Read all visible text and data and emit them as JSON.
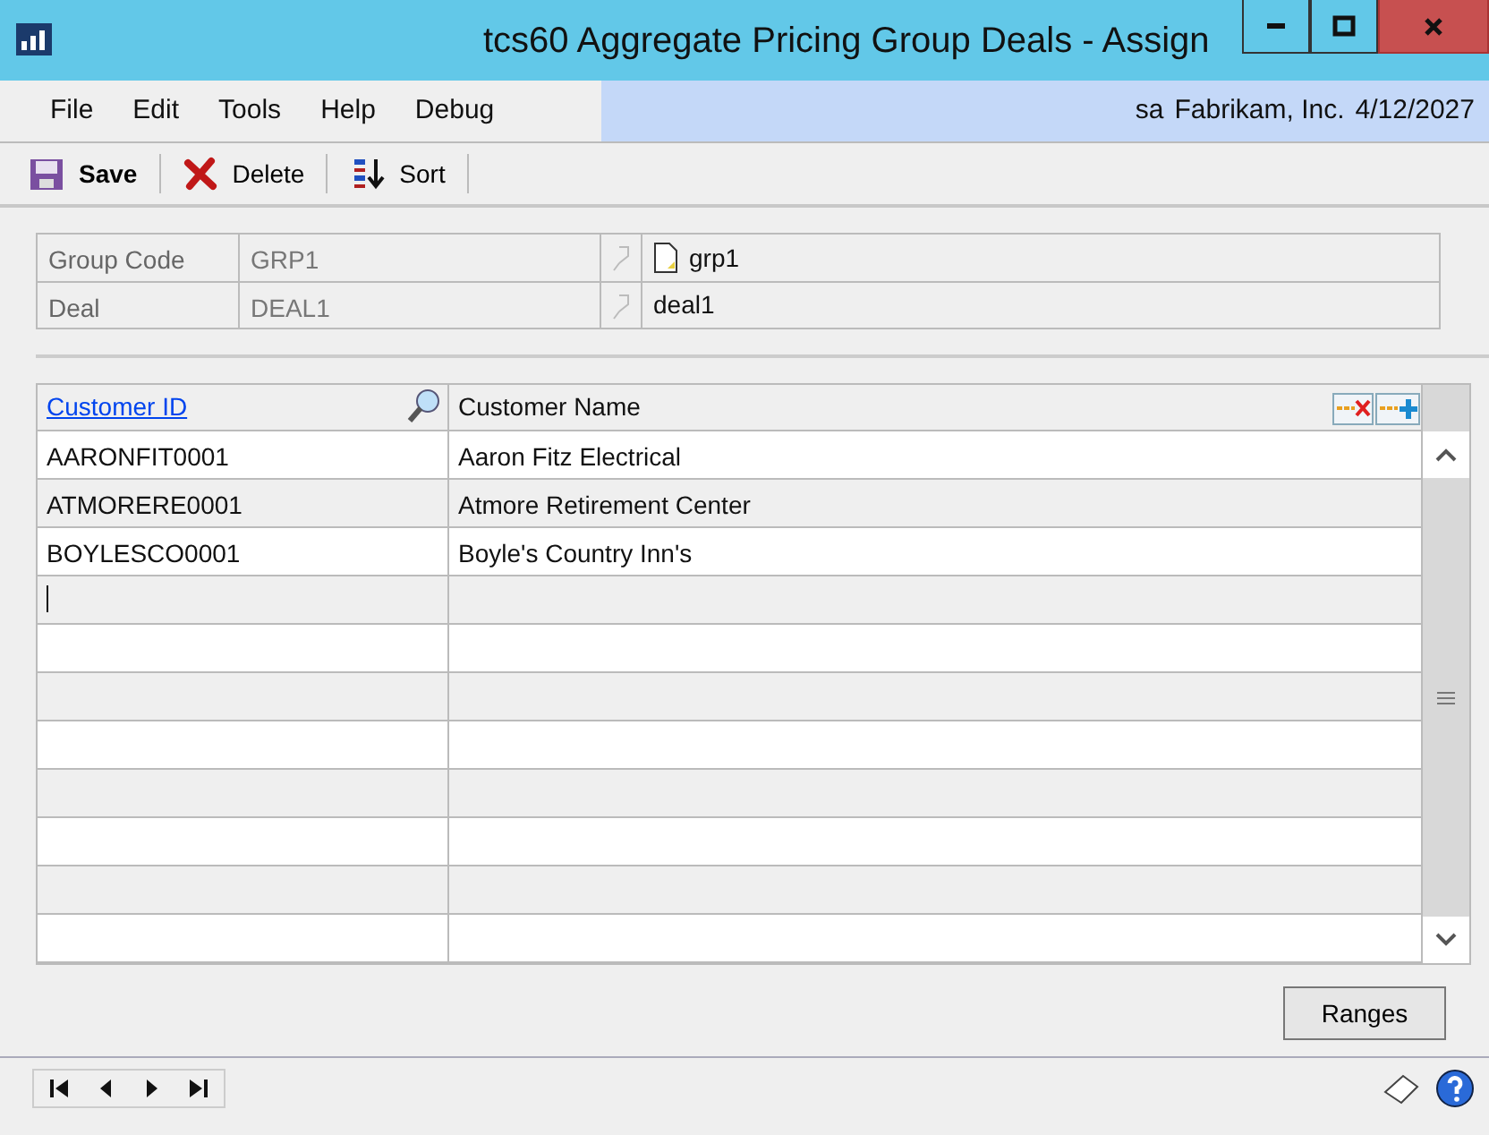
{
  "window": {
    "title": "tcs60 Aggregate Pricing Group Deals - Assign"
  },
  "menu": [
    "File",
    "Edit",
    "Tools",
    "Help",
    "Debug"
  ],
  "session": {
    "user": "sa",
    "company": "Fabrikam, Inc.",
    "date": "4/12/2027"
  },
  "toolbar": [
    {
      "kind": "save",
      "label": "Save"
    },
    {
      "kind": "delete",
      "label": "Delete"
    },
    {
      "kind": "sort",
      "label": "Sort"
    }
  ],
  "fields": [
    {
      "label": "Group Code",
      "value": "GRP1",
      "description": "grp1",
      "has_note": true
    },
    {
      "label": "Deal",
      "value": "DEAL1",
      "description": "deal1",
      "has_note": false
    }
  ],
  "table": {
    "columns": [
      {
        "label": "Customer ID",
        "link": true
      },
      {
        "label": "Customer Name",
        "link": false
      }
    ],
    "rows": [
      {
        "customer_id": "AARONFIT0001",
        "customer_name": "Aaron Fitz Electrical",
        "editing": false
      },
      {
        "customer_id": "ATMORERE0001",
        "customer_name": "Atmore Retirement Center",
        "editing": false
      },
      {
        "customer_id": "BOYLESCO0001",
        "customer_name": "Boyle's Country Inn's",
        "editing": false
      },
      {
        "editing": true
      },
      {
        "editing": false
      },
      {
        "editing": false
      },
      {
        "editing": false
      },
      {
        "editing": false
      },
      {
        "editing": false
      },
      {
        "editing": false
      },
      {
        "editing": false
      }
    ]
  },
  "buttons": [
    "Ranges"
  ]
}
